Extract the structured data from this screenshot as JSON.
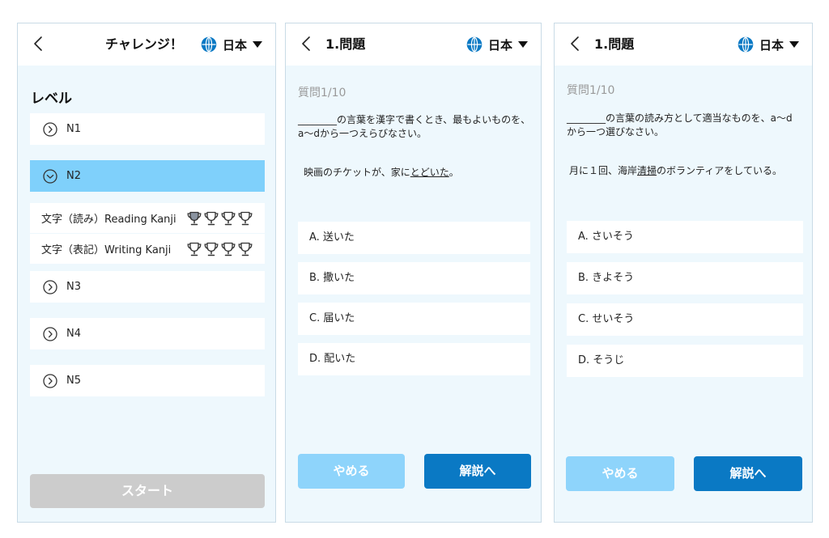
{
  "screen1": {
    "header": {
      "title": "チャレンジ！",
      "language": "日本"
    },
    "level_title": "レベル",
    "levels": [
      {
        "label": "N1"
      },
      {
        "label": "N2"
      },
      {
        "label": "N3"
      },
      {
        "label": "N4"
      },
      {
        "label": "N5"
      }
    ],
    "selected_level": "N2",
    "sub_items": [
      {
        "label": "文字（読み）Reading Kanji",
        "trophies_earned": 1,
        "trophies_total": 4
      },
      {
        "label": "文字（表記）Writing Kanji",
        "trophies_earned": 0,
        "trophies_total": 4
      }
    ],
    "start_label": "スタート"
  },
  "screen2": {
    "header": {
      "title": "1.問題",
      "language": "日本"
    },
    "question_count": "質問1/10",
    "prompt": "________の言葉を漢字で書くとき、最もよいものを、a〜dから一つえらびなさい。",
    "sentence": {
      "before": "映画のチケットが、家に",
      "target": "とどいた",
      "after": "。"
    },
    "options": [
      {
        "label": "A. 送いた"
      },
      {
        "label": "B. 撒いた"
      },
      {
        "label": "C. 届いた"
      },
      {
        "label": "D. 配いた"
      }
    ],
    "quit_label": "やめる",
    "explain_label": "解説へ"
  },
  "screen3": {
    "header": {
      "title": "1.問題",
      "language": "日本"
    },
    "question_count": "質問1/10",
    "prompt": "________の言葉の読み方として適当なものを、a〜dから一つ選びなさい。",
    "sentence": {
      "before": "月に１回、海岸",
      "target": "清掃",
      "after": "のボランティアをしている。"
    },
    "options": [
      {
        "label": "A. さいそう"
      },
      {
        "label": "B. きよそう"
      },
      {
        "label": "C. せいそう"
      },
      {
        "label": "D. そうじ"
      }
    ],
    "quit_label": "やめる",
    "explain_label": "解説へ"
  },
  "icons": {
    "back": "chevron-left-icon",
    "language": "globe-icon",
    "dropdown": "caret-down-icon",
    "level_toggle": "circle-chevron-icon",
    "achievement": "trophy-icon"
  },
  "colors": {
    "accent": "#0a79c4",
    "selected_row": "#7fd0fb",
    "quit_button": "#8ed4fb",
    "start_disabled": "#cccccc",
    "screen_background": "#eef8fd",
    "trophy_earned": "#8a93a0",
    "trophy_empty": "#ffffff"
  }
}
